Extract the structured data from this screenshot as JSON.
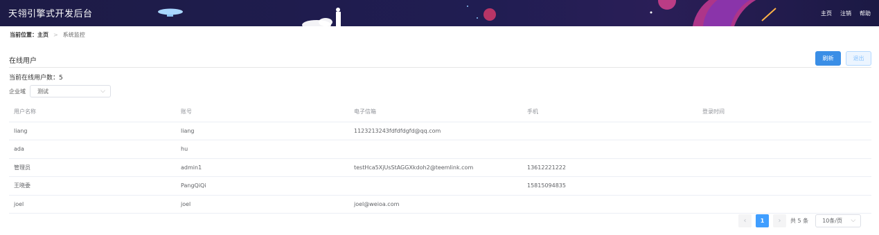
{
  "header": {
    "title": "天翎引擎式开发后台",
    "nav": [
      "主页",
      "注销",
      "帮助"
    ]
  },
  "breadcrumb": {
    "prefix": "当前位置：",
    "home": "主页",
    "separator": ">",
    "current": "系统监控"
  },
  "panel": {
    "title": "在线用户",
    "refresh_label": "刷新",
    "logout_label": "退出",
    "count_text": "当前在线用户数：5",
    "filter_label": "企业域",
    "filter_value": "测试"
  },
  "table": {
    "columns": [
      "用户名称",
      "账号",
      "电子信箱",
      "手机",
      "登录时间"
    ],
    "rows": [
      [
        "liang",
        "liang",
        "1123213243fdfdfdgfd@qq.com",
        "",
        ""
      ],
      [
        "ada",
        "hu",
        "",
        "",
        ""
      ],
      [
        "管理员",
        "admin1",
        "testHca5XjUsStAGGXkdoh2@teemlink.com",
        "13612221222",
        ""
      ],
      [
        "王晓委",
        "PangQiQi",
        "",
        "15815094835",
        ""
      ],
      [
        "joel",
        "joel",
        "joel@weioa.com",
        "",
        ""
      ]
    ]
  },
  "pagination": {
    "current_page": "1",
    "total_text": "共 5 条",
    "page_size": "10条/页"
  },
  "colors": {
    "header_bg": "#1d1b46",
    "primary": "#409eff"
  },
  "icons": [
    "prev-page-icon",
    "next-page-icon",
    "chevron-down-icon"
  ]
}
